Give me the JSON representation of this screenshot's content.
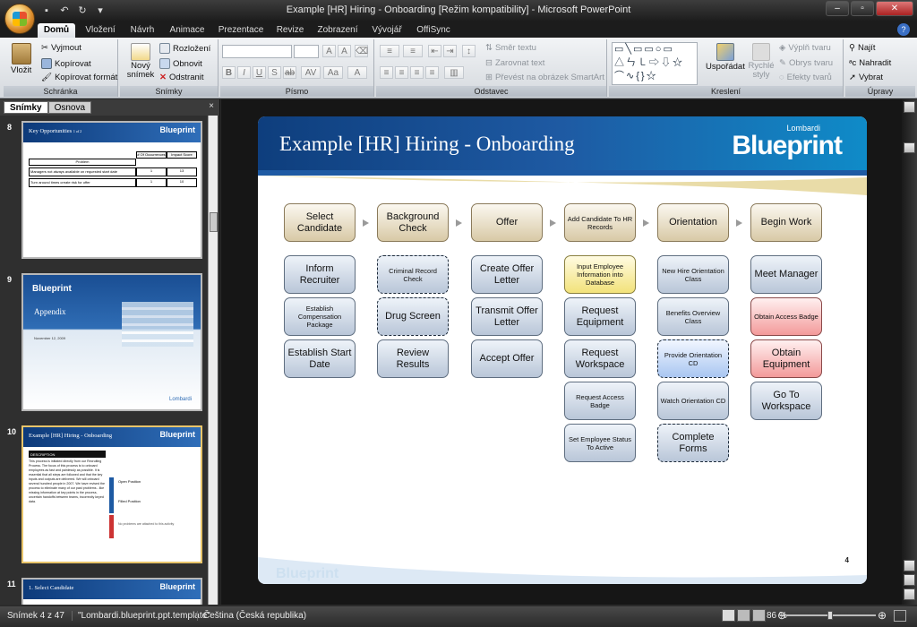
{
  "window": {
    "title": "Example [HR] Hiring - Onboarding [Režim kompatibility] - Microsoft PowerPoint"
  },
  "ribbon_tabs": [
    "Domů",
    "Vložení",
    "Návrh",
    "Animace",
    "Prezentace",
    "Revize",
    "Zobrazení",
    "Vývojář",
    "OffiSync"
  ],
  "active_tab": "Domů",
  "ribbon": {
    "clipboard": {
      "paste": "Vložit",
      "cut": "Vyjmout",
      "copy": "Kopírovat",
      "format_painter": "Kopírovat formát",
      "label": "Schránka"
    },
    "slides": {
      "new_slide": "Nový snímek",
      "layout": "Rozložení",
      "reset": "Obnovit",
      "delete": "Odstranit",
      "label": "Snímky"
    },
    "font": {
      "label": "Písmo"
    },
    "paragraph": {
      "text_direction": "Směr textu",
      "align_text": "Zarovnat text",
      "smartart": "Převést na obrázek SmartArt",
      "label": "Odstavec"
    },
    "drawing": {
      "arrange": "Uspořádat",
      "quick_styles": "Rychlé styly",
      "shape_fill": "Výplň tvaru",
      "shape_outline": "Obrys tvaru",
      "shape_effects": "Efekty tvarů",
      "label": "Kreslení"
    },
    "editing": {
      "find": "Najít",
      "replace": "Nahradit",
      "select": "Vybrat",
      "label": "Úpravy"
    }
  },
  "panel": {
    "tab_slides": "Snímky",
    "tab_outline": "Osnova",
    "close": "×"
  },
  "thumbnails": [
    {
      "num": "8",
      "title": "Key Opportunities",
      "sub": "1 of 2",
      "logo": "Blueprint",
      "table_headers": [
        "Problem",
        "# Of Occurrences",
        "Impact Score"
      ],
      "rows": [
        [
          "Managers not always available on requested start date",
          "1",
          "13"
        ],
        [
          "Turn around times create risk for offer",
          "1",
          "10"
        ]
      ]
    },
    {
      "num": "9",
      "title": "Appendix",
      "date": "November 12, 2009",
      "logo": "Blueprint",
      "footer_logo": "Lombardi"
    },
    {
      "num": "10",
      "title": "Example [HR] Hiring - Onboarding",
      "logo": "Blueprint",
      "desc_label": "DESCRIPTION",
      "desc_text": "This process is initiated directly from our Recruiting Process. The focus of this process is to onboard employees as fast and painlessly as possible. It is essential that all steps are followed and that the key inputs and outputs are delivered. We will onboard several hundred people in 2007. We have revised the process to eliminate many of our past problems - like missing information at key points in the process, uncertain handoffs between teams, incorrectly keyed data.",
      "lane_items": [
        "Open Position",
        "Filled Position",
        "No problems are attached to this activity"
      ]
    },
    {
      "num": "11",
      "title": "1. Select Candidate",
      "logo": "Blueprint"
    }
  ],
  "slide": {
    "title": "Example [HR] Hiring - Onboarding",
    "logo_small": "Lombardi",
    "logo_big": "Blueprint",
    "footer_logo": "Blueprint",
    "page_number": "4",
    "columns": [
      {
        "header": "Select Candidate",
        "items": [
          {
            "text": "Inform Recruiter",
            "style": "blue"
          },
          {
            "text": "Establish Compensation Package",
            "style": "blue-sm"
          },
          {
            "text": "Establish Start Date",
            "style": "blue"
          }
        ]
      },
      {
        "header": "Background Check",
        "items": [
          {
            "text": "Criminal Record Check",
            "style": "dash-sm"
          },
          {
            "text": "Drug Screen",
            "style": "dash"
          },
          {
            "text": "Review Results",
            "style": "blue"
          }
        ]
      },
      {
        "header": "Offer",
        "items": [
          {
            "text": "Create Offer Letter",
            "style": "blue"
          },
          {
            "text": "Transmit Offer Letter",
            "style": "blue"
          },
          {
            "text": "Accept Offer",
            "style": "blue"
          }
        ]
      },
      {
        "header": "Add Candidate To HR Records",
        "items": [
          {
            "text": "Input Employee Information into Database",
            "style": "yellow-sm"
          },
          {
            "text": "Request Equipment",
            "style": "blue"
          },
          {
            "text": "Request Workspace",
            "style": "blue"
          },
          {
            "text": "Request Access Badge",
            "style": "blue-sm"
          },
          {
            "text": "Set Employee Status To Active",
            "style": "blue-sm"
          }
        ]
      },
      {
        "header": "Orientation",
        "items": [
          {
            "text": "New Hire Orientation Class",
            "style": "blue-sm"
          },
          {
            "text": "Benefits Overview Class",
            "style": "blue-sm"
          },
          {
            "text": "Provide Orientation CD",
            "style": "light-dash-sm"
          },
          {
            "text": "Watch Orientation CD",
            "style": "blue-sm"
          },
          {
            "text": "Complete Forms",
            "style": "dash"
          }
        ]
      },
      {
        "header": "Begin Work",
        "items": [
          {
            "text": "Meet Manager",
            "style": "blue"
          },
          {
            "text": "Obtain Access Badge",
            "style": "red-sm"
          },
          {
            "text": "Obtain Equipment",
            "style": "red"
          },
          {
            "text": "Go To Workspace",
            "style": "blue"
          }
        ]
      }
    ]
  },
  "status": {
    "slide": "Snímek 4 z 47",
    "template": "\"Lombardi.blueprint.ppt.template\"",
    "language": "Čeština (Česká republika)",
    "zoom": "86 %"
  }
}
